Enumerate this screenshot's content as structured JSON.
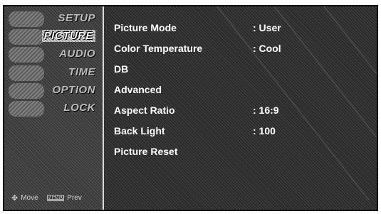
{
  "sidebar": {
    "items": [
      {
        "label": "SETUP",
        "icon": "setup-icon"
      },
      {
        "label": "PICTURE",
        "icon": "picture-icon",
        "active": true
      },
      {
        "label": "AUDIO",
        "icon": "audio-icon"
      },
      {
        "label": "TIME",
        "icon": "time-icon"
      },
      {
        "label": "OPTION",
        "icon": "option-icon"
      },
      {
        "label": "LOCK",
        "icon": "lock-icon"
      }
    ],
    "help": {
      "move_label": "Move",
      "back_key": "MENU",
      "prev_label": "Prev"
    }
  },
  "picture_menu": {
    "rows": [
      {
        "label": "Picture Mode",
        "value": ": User"
      },
      {
        "label": "Color Temperature",
        "value": ": Cool"
      },
      {
        "label": "DB",
        "value": ""
      },
      {
        "label": "Advanced",
        "value": ""
      },
      {
        "label": "Aspect Ratio",
        "value": ": 16:9"
      },
      {
        "label": "Back Light",
        "value": ": 100"
      },
      {
        "label": "Picture Reset",
        "value": ""
      }
    ]
  }
}
